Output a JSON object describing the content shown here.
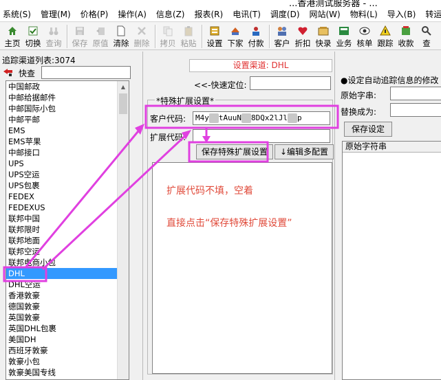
{
  "window": {
    "title": "...香港测试服务器 - ..."
  },
  "menu": [
    "系统(S)",
    "管理(M)",
    "价格(P)",
    "操作(A)",
    "信息(Z)",
    "报表(R)",
    "电讯(T)",
    "调度(D)",
    "网站(W)",
    "物料(L)",
    "导入(B)",
    "转运(H)"
  ],
  "toolbar": [
    {
      "label": "主页",
      "icon": "home-icon",
      "disabled": false
    },
    {
      "label": "切换",
      "icon": "switch-icon",
      "disabled": false
    },
    {
      "label": "查询",
      "icon": "binoculars-icon",
      "disabled": true
    },
    {
      "sep": true
    },
    {
      "label": "保存",
      "icon": "save-icon",
      "disabled": true
    },
    {
      "label": "原值",
      "icon": "revert-icon",
      "disabled": true
    },
    {
      "label": "清除",
      "icon": "clear-icon",
      "disabled": false
    },
    {
      "label": "删除",
      "icon": "delete-icon",
      "disabled": true
    },
    {
      "sep": true
    },
    {
      "label": "拷贝",
      "icon": "copy-icon",
      "disabled": true
    },
    {
      "label": "粘贴",
      "icon": "paste-icon",
      "disabled": true
    },
    {
      "sep": true
    },
    {
      "label": "设置",
      "icon": "settings-icon",
      "disabled": false
    },
    {
      "label": "下家",
      "icon": "downstream-icon",
      "disabled": false
    },
    {
      "label": "付款",
      "icon": "payment-icon",
      "disabled": false
    },
    {
      "sep": true
    },
    {
      "label": "客户",
      "icon": "customers-icon",
      "disabled": false
    },
    {
      "label": "折扣",
      "icon": "discount-icon",
      "disabled": false
    },
    {
      "label": "快录",
      "icon": "quick-entry-icon",
      "disabled": false
    },
    {
      "label": "业务",
      "icon": "business-icon",
      "disabled": false
    },
    {
      "label": "核单",
      "icon": "verify-icon",
      "disabled": false
    },
    {
      "label": "跟踪",
      "icon": "track-icon",
      "disabled": false
    },
    {
      "label": "收款",
      "icon": "receive-icon",
      "disabled": false
    },
    {
      "label": "查",
      "icon": "search-icon",
      "disabled": false
    }
  ],
  "left": {
    "list_title": "追踪渠道列表:3074",
    "search_label": "快查",
    "items": [
      "中国邮政",
      "中邮给据邮件",
      "中邮国际小包",
      "中邮平邮",
      "EMS",
      "EMS苹果",
      "中邮接口",
      "UPS",
      "UPS空运",
      "UPS包裹",
      "FEDEX",
      "FEDEXUS",
      "联邦中国",
      "联邦限时",
      "联邦地面",
      "联邦空运",
      "联邦电商小包",
      "DHL",
      "DHL空运",
      "香港敦豪",
      "德国敦豪",
      "英国敦豪",
      "英国DHL包裹",
      "美国DH",
      "西班牙敦豪",
      "敦豪小包",
      "敦豪美国专线"
    ],
    "selected_index": 17
  },
  "center": {
    "channel": "设置渠道: DHL",
    "quick_label": "<<-快速定位:",
    "group_title": "*特殊扩展设置*",
    "code_label": "客户代码:",
    "code_value": [
      "M4y",
      "tAuuN",
      "8DQx2lJl",
      "p"
    ],
    "ext_label": "扩展代码:",
    "save_ext_button": "保存特殊扩展设置",
    "multi_config_button": "↓编辑多配置",
    "note1": "扩展代码不填，空着",
    "note2": "直接点击“保存特殊扩展设置”"
  },
  "right": {
    "title": "●设定自动追踪信息的修改",
    "orig_label": "原始字串:",
    "replace_label": "替换成为:",
    "save_button": "保存设定",
    "grid_header": "原始字符串"
  },
  "colors": {
    "annotation": "#e040e0",
    "selection": "#3399ff",
    "note_text": "#e04a3a",
    "channel_text": "#e03030"
  }
}
